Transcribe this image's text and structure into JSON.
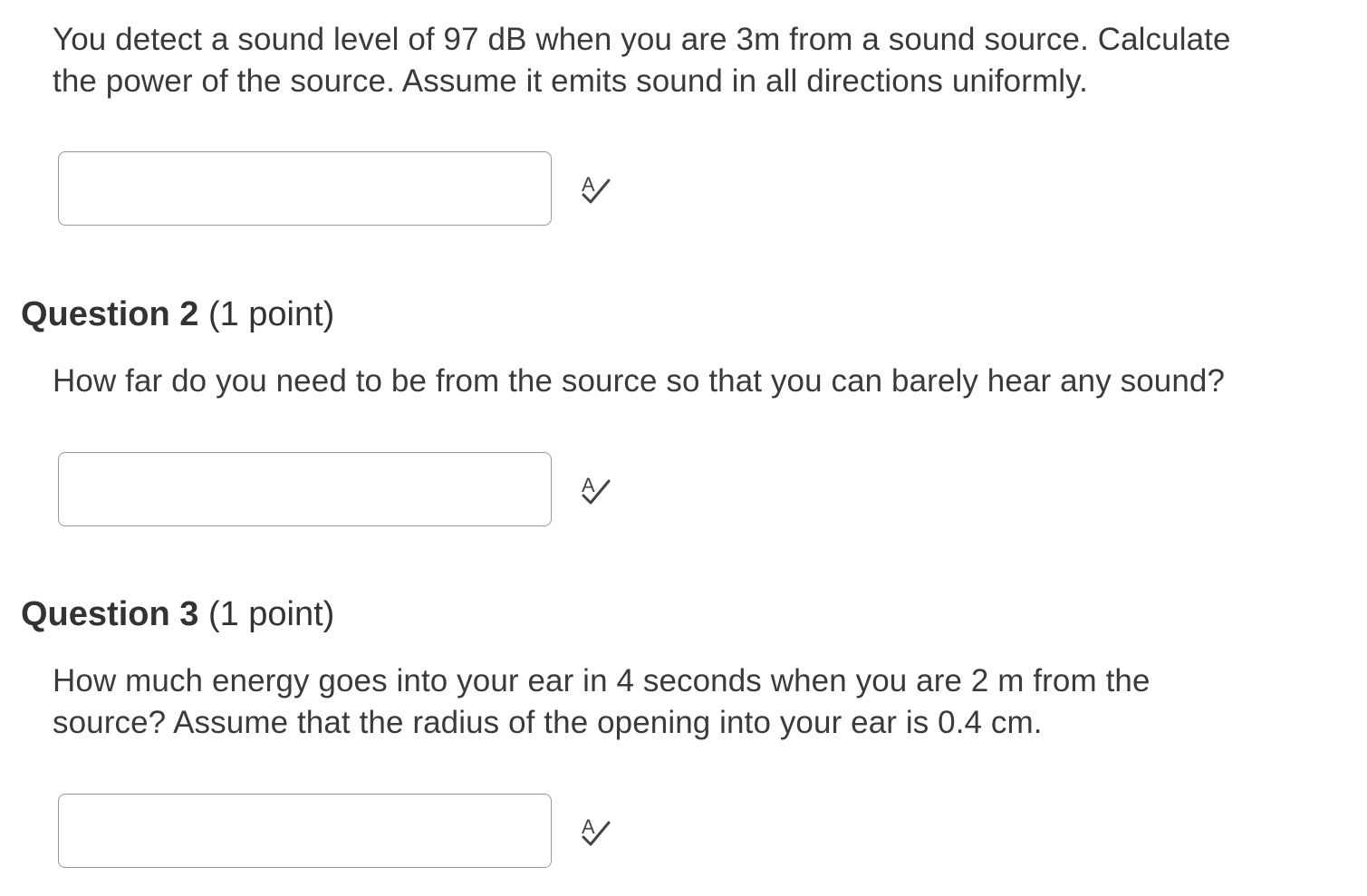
{
  "questions": [
    {
      "prompt_lines": [
        "You detect a sound level of 97 dB when you are 3m from a sound source. Calculate",
        "the power of the source. Assume it emits sound in all directions uniformly."
      ],
      "answer_value": "",
      "spellcheck_icon": "spellcheck-icon"
    },
    {
      "title": "Question 2",
      "points": "(1 point)",
      "prompt_lines": [
        "How far do you need to be from the source so that you can barely hear any sound?"
      ],
      "answer_value": "",
      "spellcheck_icon": "spellcheck-icon"
    },
    {
      "title": "Question 3",
      "points": "(1 point)",
      "prompt_lines": [
        "How much energy goes into your ear in 4 seconds when you are 2 m from the",
        "source? Assume that the radius of the opening into your ear is 0.4 cm."
      ],
      "answer_value": "",
      "spellcheck_icon": "spellcheck-icon"
    }
  ]
}
